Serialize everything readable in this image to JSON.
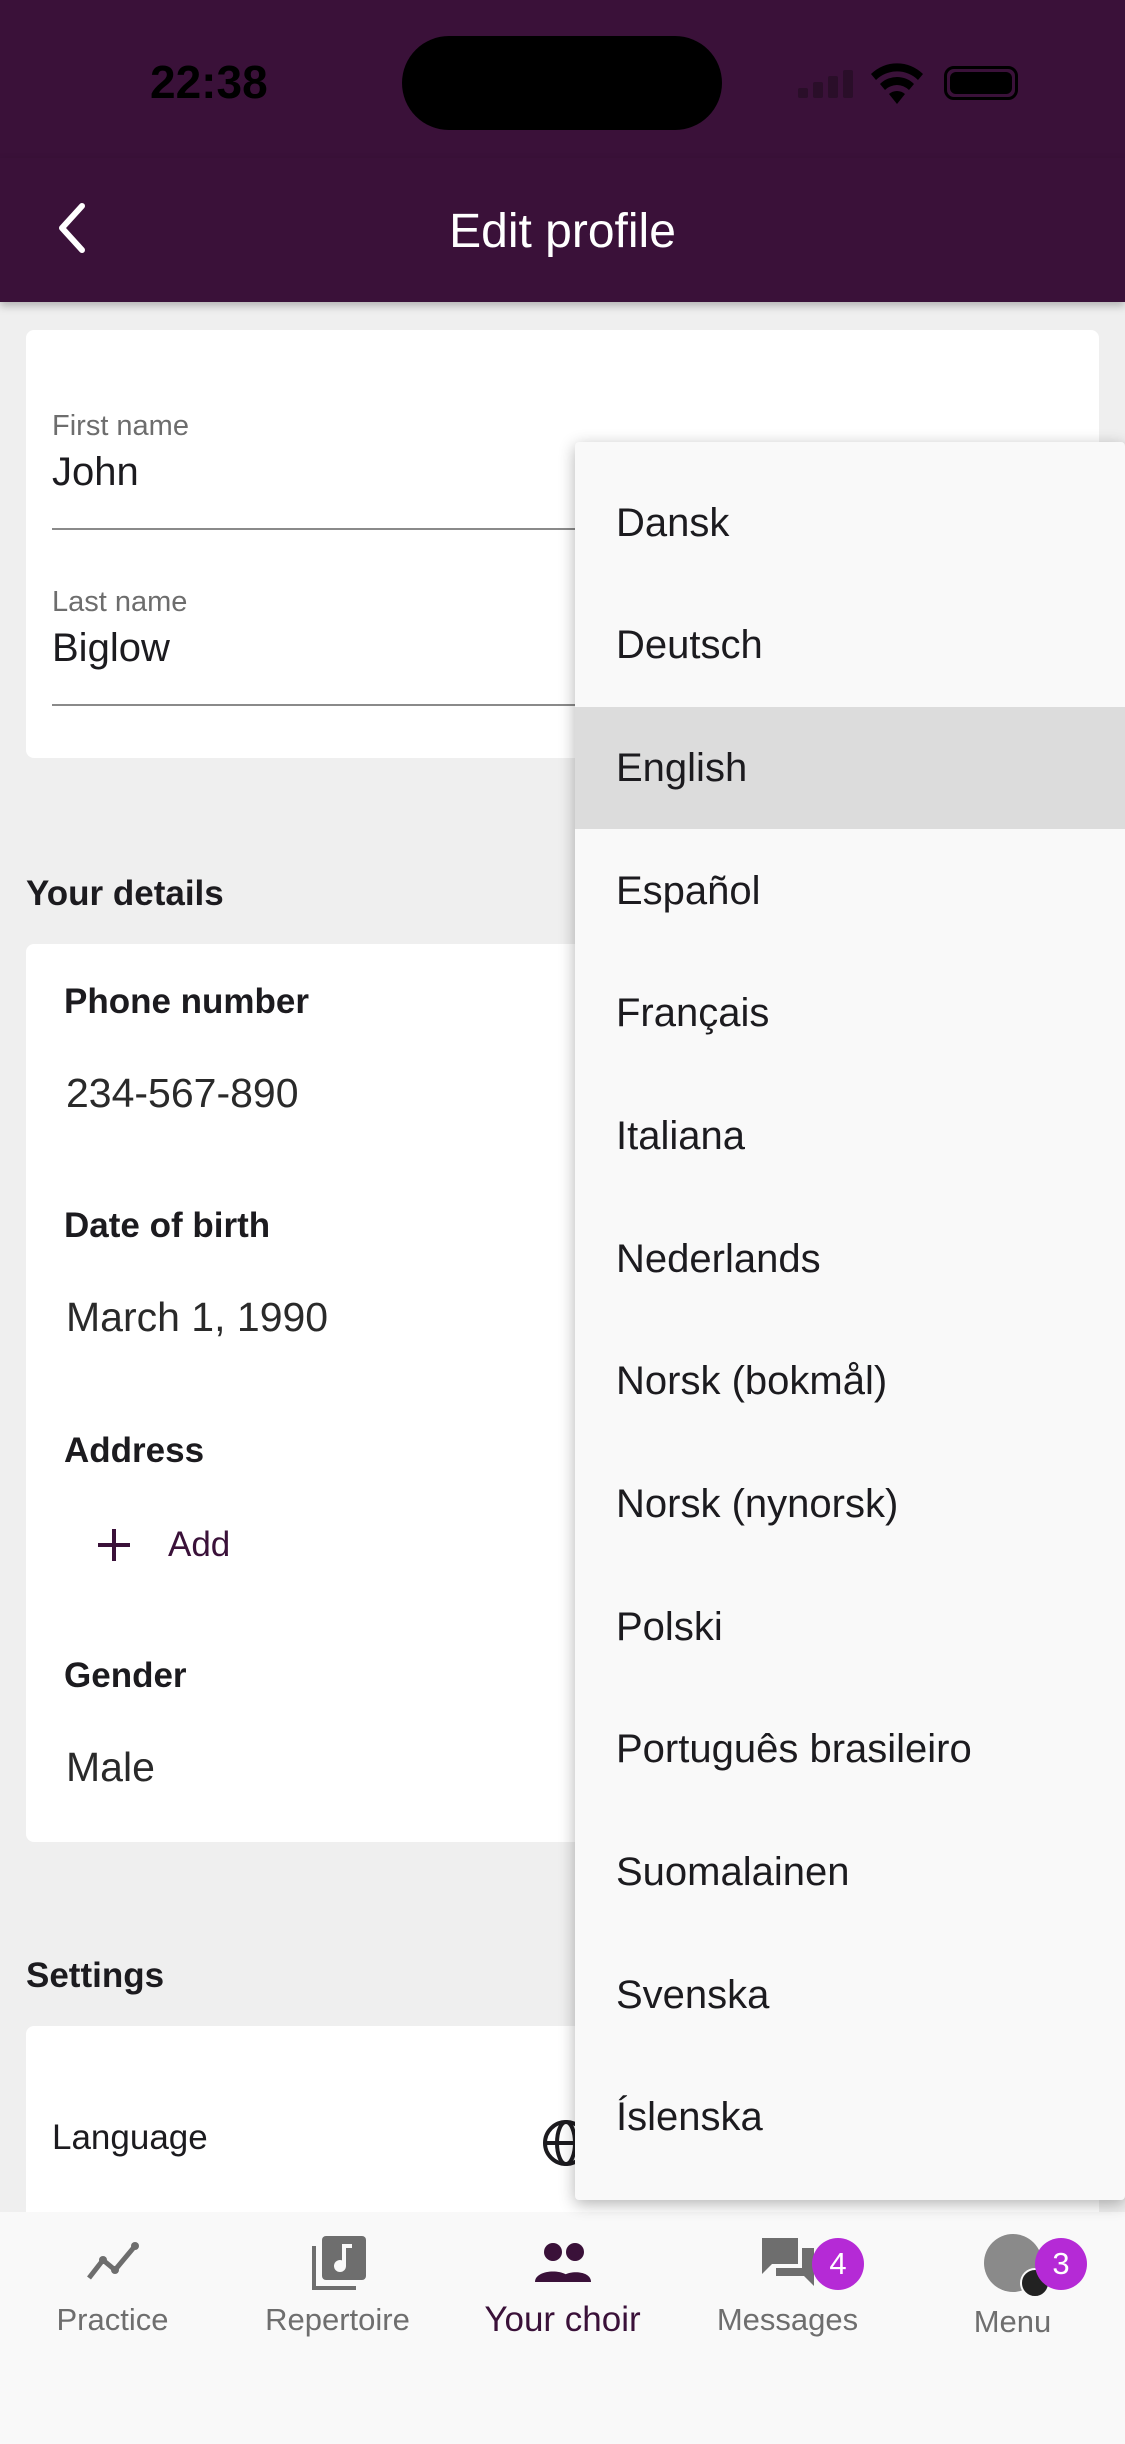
{
  "status_bar": {
    "time": "22:38"
  },
  "header": {
    "title": "Edit profile"
  },
  "name_card": {
    "first_name_label": "First name",
    "first_name_value": "John",
    "last_name_label": "Last name",
    "last_name_value": "Biglow"
  },
  "details": {
    "section_title": "Your details",
    "phone_label": "Phone number",
    "phone_value": "234-567-890",
    "dob_label": "Date of birth",
    "dob_value": "March 1, 1990",
    "address_label": "Address",
    "address_add_label": "Add",
    "gender_label": "Gender",
    "gender_value": "Male"
  },
  "settings": {
    "section_title": "Settings",
    "language_label": "Language"
  },
  "language_menu": {
    "selected": "English",
    "options": [
      "Dansk",
      "Deutsch",
      "English",
      "Español",
      "Français",
      "Italiana",
      "Nederlands",
      "Norsk (bokmål)",
      "Norsk (nynorsk)",
      "Polski",
      "Português brasileiro",
      "Suomalainen",
      "Svenska",
      "Íslenska"
    ]
  },
  "bottom_nav": {
    "items": [
      {
        "label": "Practice",
        "icon": "practice-chart-icon"
      },
      {
        "label": "Repertoire",
        "icon": "music-note-icon"
      },
      {
        "label": "Your choir",
        "icon": "people-icon",
        "active": true
      },
      {
        "label": "Messages",
        "icon": "messages-icon",
        "badge": "4"
      },
      {
        "label": "Menu",
        "icon": "avatar",
        "badge": "3"
      }
    ]
  },
  "colors": {
    "primary": "#3a1139",
    "badge": "#b52ad6",
    "selected_row": "#dcdcdc"
  }
}
